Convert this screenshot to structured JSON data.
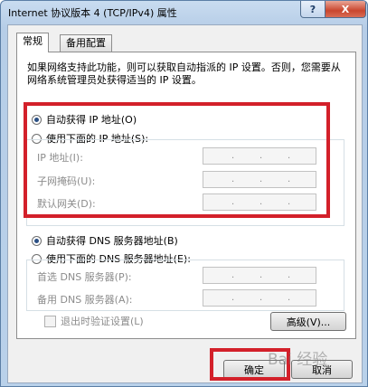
{
  "window": {
    "title": "Internet 协议版本 4 (TCP/IPv4) 属性",
    "help_label": "?",
    "close_label": "X"
  },
  "tabs": [
    {
      "label": "常规"
    },
    {
      "label": "备用配置"
    }
  ],
  "description": "如果网络支持此功能，则可以获取自动指派的 IP 设置。否则，您需要从网络系统管理员处获得适当的 IP 设置。",
  "ip_section": {
    "auto_label": "自动获得 IP 地址(O)",
    "manual_label": "使用下面的 IP 地址(S):",
    "auto_selected": true,
    "fields": [
      {
        "label": "IP 地址(I):"
      },
      {
        "label": "子网掩码(U):"
      },
      {
        "label": "默认网关(D):"
      }
    ]
  },
  "dns_section": {
    "auto_label": "自动获得 DNS 服务器地址(B)",
    "manual_label": "使用下面的 DNS 服务器地址(E):",
    "auto_selected": true,
    "fields": [
      {
        "label": "首选 DNS 服务器(P):"
      },
      {
        "label": "备用 DNS 服务器(A):"
      }
    ]
  },
  "validate_label": "退出时验证设置(L)",
  "advanced_label": "高级(V)...",
  "ok_label": "确定",
  "cancel_label": "取消",
  "watermark_text": "Bai 经验"
}
